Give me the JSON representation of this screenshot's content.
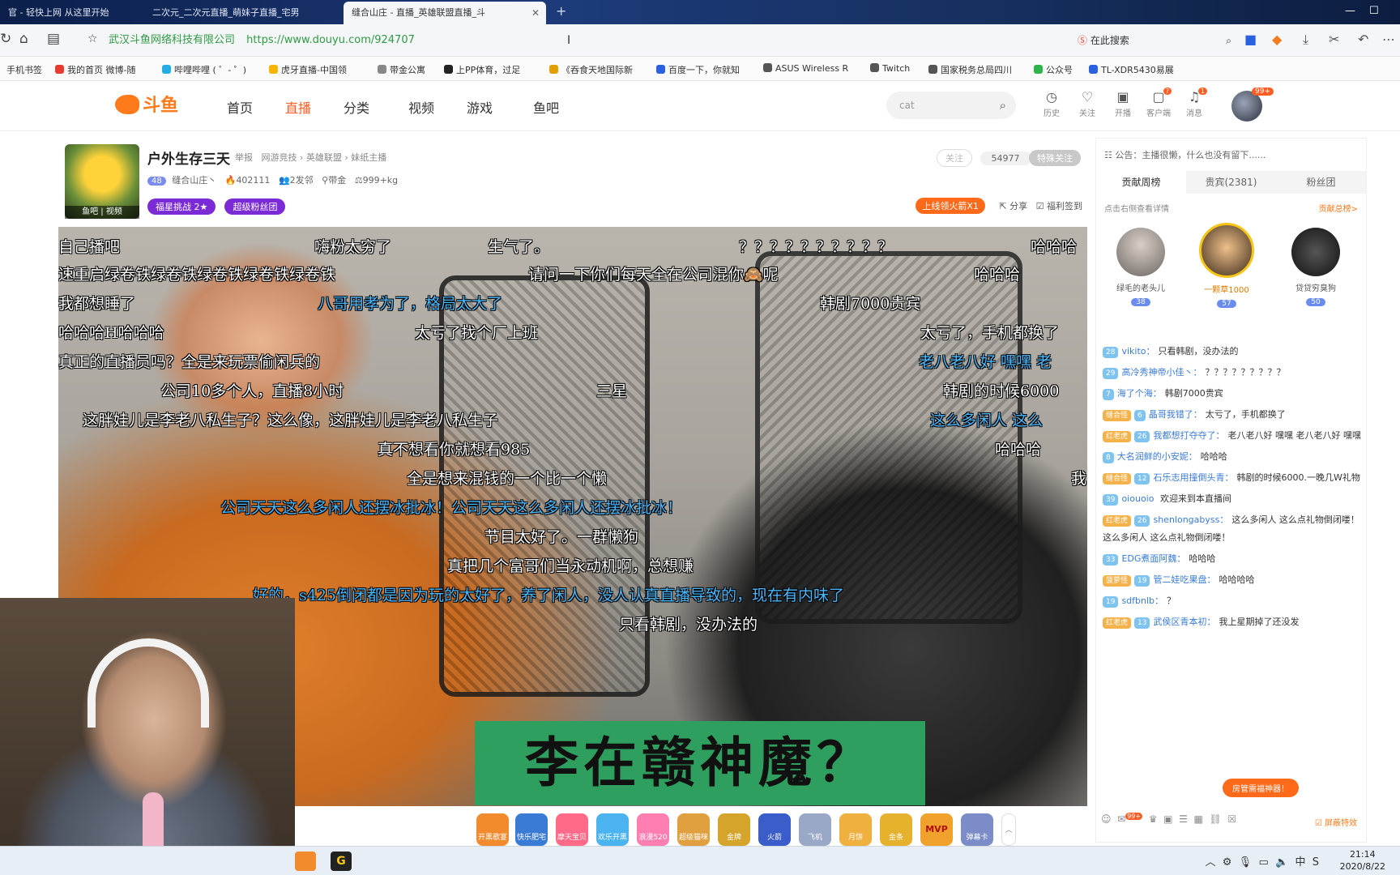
{
  "browser": {
    "tabs": [
      {
        "label": "官 - 轻快上网 从这里开始"
      },
      {
        "label": "二次元_二次元直播_萌妹子直播_宅男"
      },
      {
        "label": "缝合山庄 - 直播_英雄联盟直播_斗"
      }
    ],
    "address": {
      "cert": "武汉斗鱼网络科技有限公司",
      "url": "https://www.douyu.com/924707",
      "search_engine_label": "在此搜索"
    },
    "bookmarks": [
      {
        "label": "手机书签",
        "color": "#888888"
      },
      {
        "label": "我的首页 微博-随",
        "color": "#e63b2e"
      },
      {
        "label": "哔哩哔哩 ( ゜- ゜)",
        "color": "#23ade5"
      },
      {
        "label": "虎牙直播-中国领",
        "color": "#f5b400"
      },
      {
        "label": "带金公寓",
        "color": "#888888"
      },
      {
        "label": "上PP体育，过足",
        "color": "#222222"
      },
      {
        "label": "《吞食天地国际新",
        "color": "#e0a100"
      },
      {
        "label": "百度一下，你就知",
        "color": "#2a61e0"
      },
      {
        "label": "ASUS Wireless R",
        "color": "#555555"
      },
      {
        "label": "Twitch",
        "color": "#555555"
      },
      {
        "label": "国家税务总局四川",
        "color": "#555555"
      },
      {
        "label": "公众号",
        "color": "#2fb34a"
      },
      {
        "label": "TL-XDR5430易展",
        "color": "#2a61e0"
      }
    ]
  },
  "site": {
    "logo": "斗鱼",
    "nav": [
      "首页",
      "直播",
      "分类",
      "视频",
      "游戏",
      "鱼吧"
    ],
    "active_nav": "直播",
    "search_value": "cat",
    "header_icons": [
      {
        "label": "历史",
        "icon": "clock-icon"
      },
      {
        "label": "关注",
        "icon": "heart-icon"
      },
      {
        "label": "开播",
        "icon": "camera-icon"
      },
      {
        "label": "客户端",
        "icon": "client-icon",
        "badge": "?"
      },
      {
        "label": "消息",
        "icon": "bell-icon",
        "badge": "1"
      }
    ],
    "avatar_badge": "99+"
  },
  "room": {
    "title": "户外生存三天",
    "report": "举报",
    "category_path": "网游竞技 › 英雄联盟 › 妹纸主播",
    "level_badge": "48",
    "anchor_name": "缝合山庄丶",
    "hot": "402111",
    "fans": "2发邻",
    "tag": "带金",
    "weight": "999+kg",
    "avatar_caption": "鱼吧  |  视频",
    "challenge_btn": "福星挑战",
    "challenge_stars": "2★",
    "fanclub_btn": "超级粉丝团",
    "follow_btn": "关注",
    "follow_count": "54977",
    "special_follow": "特殊关注",
    "fire_badge": "上线领火箭X1",
    "share": "分享",
    "signin": "福利签到"
  },
  "video": {
    "danmu": [
      {
        "text": "自己播吧",
        "color": "white"
      },
      {
        "text": "嗨粉太穷了",
        "color": "white"
      },
      {
        "text": "生气了。",
        "color": "white"
      },
      {
        "text": "？？？？？？？？？？",
        "color": "white"
      },
      {
        "text": "哈哈哈",
        "color": "white"
      },
      {
        "text": "速重启绿卷铁绿卷铁绿卷铁绿卷铁绿卷铁",
        "color": "white"
      },
      {
        "text": "请问一下你们每天全在公司混你🙈呢",
        "color": "white"
      },
      {
        "text": "哈哈哈",
        "color": "white"
      },
      {
        "text": "我都想睡了",
        "color": "white"
      },
      {
        "text": "八哥用孝为了，格局太大了",
        "color": "blue"
      },
      {
        "text": "韩剧7000贵宾",
        "color": "white"
      },
      {
        "text": "哈哈哈H哈哈哈",
        "color": "white"
      },
      {
        "text": "太亏了找个厂上班",
        "color": "white"
      },
      {
        "text": "太亏了，手机都换了",
        "color": "white"
      },
      {
        "text": "真正的直播员吗？全是来玩票偷闲兵的",
        "color": "white"
      },
      {
        "text": "老八老八好 嘿嘿 老",
        "color": "blue"
      },
      {
        "text": "公司10多个人，直播8小时",
        "color": "white"
      },
      {
        "text": "三星",
        "color": "white"
      },
      {
        "text": "韩剧的时候6000",
        "color": "white"
      },
      {
        "text": "这胖娃儿是李老八私生子？这么像，这胖娃儿是李老八私生子",
        "color": "white"
      },
      {
        "text": "这么多闲人 这么",
        "color": "blue"
      },
      {
        "text": "真不想看你就想看985",
        "color": "white"
      },
      {
        "text": "哈哈哈",
        "color": "white"
      },
      {
        "text": "全是想来混钱的一个比一个懒",
        "color": "white"
      },
      {
        "text": "我",
        "color": "white"
      },
      {
        "text": "公司天天这么多闲人还摆冰批冰！公司天天这么多闲人还摆冰批冰！",
        "color": "blue"
      },
      {
        "text": "节目太好了。一群懒狗",
        "color": "white"
      },
      {
        "text": "真把几个富哥们当永动机啊，总想赚",
        "color": "white"
      },
      {
        "text": "好的，s425倒闭都是因为玩的太好了，养了闲人，没人认真直播导致的，现在有内味了",
        "color": "blue"
      },
      {
        "text": "只看韩剧，没办法的",
        "color": "white"
      }
    ],
    "caption": "李在赣神魔？"
  },
  "gifts": [
    {
      "label": "开黑歌宴",
      "color": "#f28a2e"
    },
    {
      "label": "快乐肥宅",
      "color": "#3a7bd5"
    },
    {
      "label": "摩天宝贝",
      "color": "#ff6a88"
    },
    {
      "label": "欢乐开黑",
      "color": "#4bb4f0"
    },
    {
      "label": "浪漫520",
      "color": "#ff7eb1"
    },
    {
      "label": "超级猫咪",
      "color": "#e0a040"
    },
    {
      "label": "金牌",
      "color": "#d4a52a"
    },
    {
      "label": "火箭",
      "color": "#3b5dc9"
    },
    {
      "label": "飞机",
      "color": "#9aa8c8"
    },
    {
      "label": "月饼",
      "color": "#f0b040"
    },
    {
      "label": "金条",
      "color": "#e6b22d"
    },
    {
      "label": "MVP",
      "color": "#f0a22d"
    },
    {
      "label": "弹幕卡",
      "color": "#7b8cc8"
    }
  ],
  "sidebar": {
    "notice": "公告：主播很懒，什么也没有留下......",
    "tabs": [
      "贡献周榜",
      "贵宾(2381)",
      "粉丝团"
    ],
    "rank_hint": "点击右侧查看详情",
    "rank_more": "贡献总榜>",
    "top3": [
      {
        "name": "绿毛的老头儿",
        "level": "38"
      },
      {
        "name": "一颗草1000",
        "level": "57"
      },
      {
        "name": "贷贷穷臭狗",
        "level": "50"
      }
    ],
    "chat": [
      {
        "level": "28",
        "fan": "",
        "nick": "vikito：",
        "text": "只看韩剧，没办法的"
      },
      {
        "level": "29",
        "fan": "",
        "nick": "高冷秀神帝小佳丶：",
        "text": "？？？？？？？？？"
      },
      {
        "level": "7",
        "fan": "",
        "nick": "海了个海：",
        "text": "韩剧7000贵宾"
      },
      {
        "level": "6",
        "fan": "缝合怪",
        "nick": "晶哥我错了：",
        "text": "太亏了，手机都换了"
      },
      {
        "level": "26",
        "fan": "红老虎",
        "nick": "我都想打夺夺了：",
        "text": "老八老八好 嘿嘿 老八老八好 嘿嘿"
      },
      {
        "level": "8",
        "fan": "",
        "nick": "大名润鲜的小安妮：",
        "text": "哈哈哈"
      },
      {
        "level": "12",
        "fan": "缝合怪",
        "nick": "石乐志用撞倒头青：",
        "text": "韩剧的时候6000.一晚几W礼物"
      },
      {
        "level": "39",
        "fan": "",
        "nick": "oiouoio",
        "text": "欢迎来到本直播间"
      },
      {
        "level": "26",
        "fan": "红老虎",
        "nick": "shenlongabyss：",
        "text": "这么多闲人 这么点礼物倒闭喽！ 这么多闲人 这么点礼物倒闭喽！"
      },
      {
        "level": "33",
        "fan": "",
        "nick": "EDG煮面阿魏：",
        "text": "哈哈哈"
      },
      {
        "level": "19",
        "fan": "菠萝怪",
        "nick": "管二娃吃果盘：",
        "text": "哈哈哈哈"
      },
      {
        "level": "19",
        "fan": "",
        "nick": "sdfbnlb：",
        "text": "？"
      },
      {
        "level": "13",
        "fan": "红老虎",
        "nick": "武侯区青本初：",
        "text": "我上星期掉了还没发"
      }
    ],
    "float_btn": "房管需福神器！",
    "effects_label": "屏蔽特效",
    "emoji_badge": "99+"
  },
  "taskbar": {
    "time": "21:14",
    "date": "2020/8/22"
  }
}
